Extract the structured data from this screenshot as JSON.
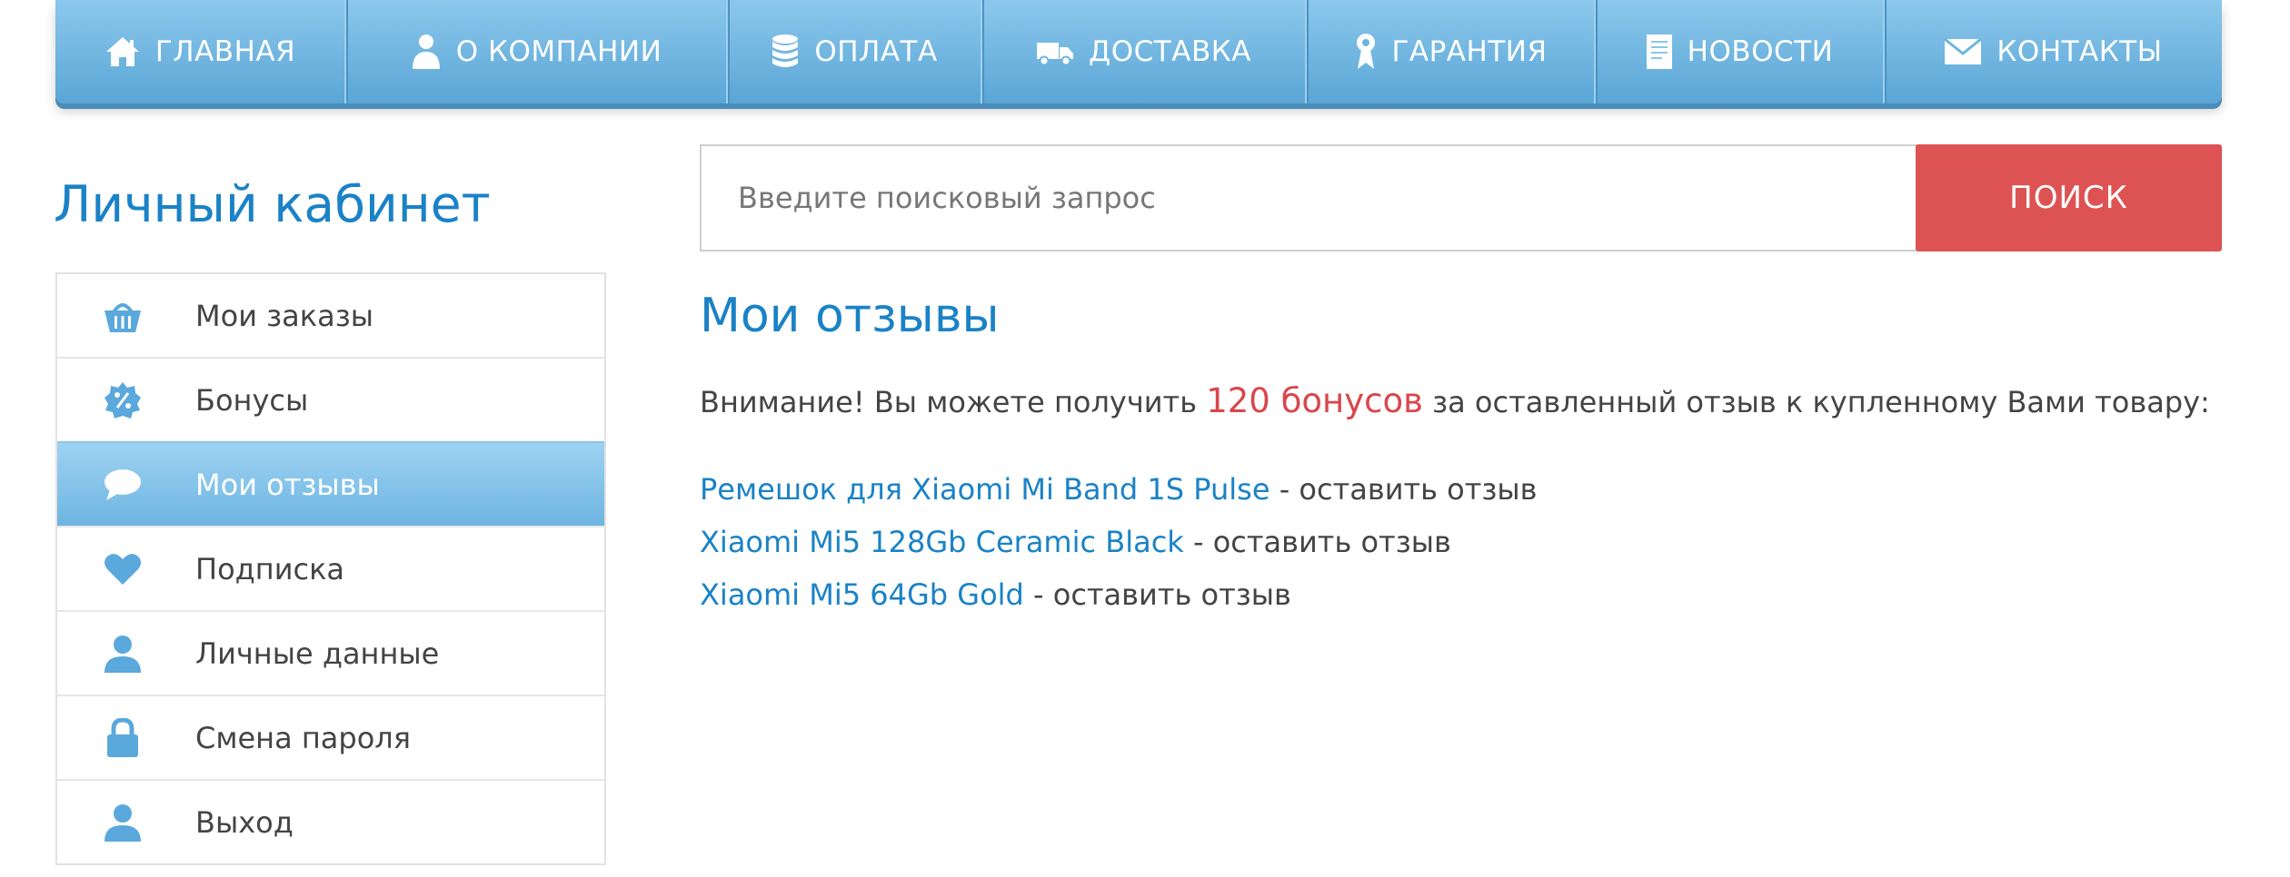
{
  "nav": {
    "items": [
      {
        "label": "ГЛАВНАЯ",
        "icon": "home-icon"
      },
      {
        "label": "О КОМПАНИИ",
        "icon": "person-icon"
      },
      {
        "label": "ОПЛАТА",
        "icon": "coins-icon"
      },
      {
        "label": "ДОСТАВКА",
        "icon": "truck-icon"
      },
      {
        "label": "ГАРАНТИЯ",
        "icon": "medal-icon"
      },
      {
        "label": "НОВОСТИ",
        "icon": "document-icon"
      },
      {
        "label": "КОНТАКТЫ",
        "icon": "envelope-icon"
      }
    ]
  },
  "sidebar": {
    "title": "Личный кабинет",
    "items": [
      {
        "label": "Мои заказы",
        "icon": "basket-icon"
      },
      {
        "label": "Бонусы",
        "icon": "percent-badge-icon"
      },
      {
        "label": "Мои отзывы",
        "icon": "speech-bubble-icon",
        "active": true
      },
      {
        "label": "Подписка",
        "icon": "heart-icon"
      },
      {
        "label": "Личные данные",
        "icon": "user-icon"
      },
      {
        "label": "Смена пароля",
        "icon": "lock-icon"
      },
      {
        "label": "Выход",
        "icon": "user-icon"
      }
    ]
  },
  "search": {
    "placeholder": "Введите поисковый запрос",
    "button_label": "ПОИСК"
  },
  "main": {
    "title": "Мои отзывы",
    "notice_before": "Внимание! Вы можете получить ",
    "notice_bonus": "120 бонусов",
    "notice_after": " за оставленный отзыв к купленному Вами товару:",
    "reviews": [
      {
        "product": "Ремешок для Xiaomi Mi Band 1S Pulse",
        "action": " - оставить отзыв"
      },
      {
        "product": "Xiaomi Mi5 128Gb Ceramic Black",
        "action": " - оставить отзыв"
      },
      {
        "product": "Xiaomi Mi5 64Gb Gold",
        "action": " - оставить отзыв"
      }
    ]
  },
  "colors": {
    "accent_blue": "#1a82c6",
    "nav_blue": "#6cb4e0",
    "bonus_red": "#d9464e",
    "search_button": "#dd5353",
    "icon_blue": "#5aa8dc"
  }
}
